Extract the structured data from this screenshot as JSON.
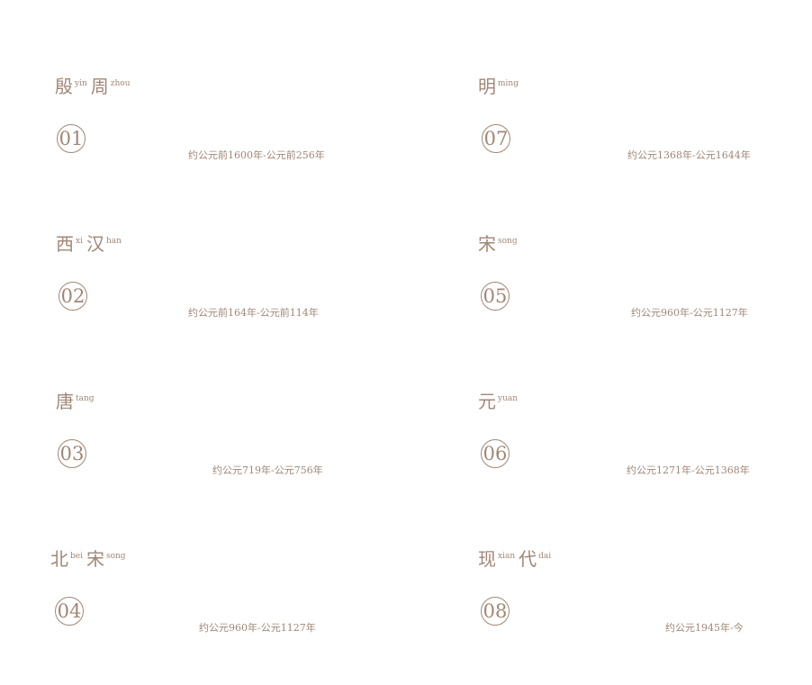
{
  "dynasties": [
    {
      "no": "01",
      "name": [
        {
          "c": "殷",
          "p": "yin"
        },
        {
          "c": "周",
          "p": "zhou"
        }
      ],
      "period": "约公元前1600年-公元前256年"
    },
    {
      "no": "02",
      "name": [
        {
          "c": "西",
          "p": "xi"
        },
        {
          "c": "汉",
          "p": "han"
        }
      ],
      "period": "约公元前164年-公元前114年"
    },
    {
      "no": "03",
      "name": [
        {
          "c": "唐",
          "p": "tang"
        }
      ],
      "period": "约公元719年-公元756年"
    },
    {
      "no": "04",
      "name": [
        {
          "c": "北",
          "p": "bei"
        },
        {
          "c": "宋",
          "p": "song"
        }
      ],
      "period": "约公元960年-公元1127年"
    },
    {
      "no": "07",
      "name": [
        {
          "c": "明",
          "p": "ming"
        }
      ],
      "period": "约公元1368年-公元1644年"
    },
    {
      "no": "05",
      "name": [
        {
          "c": "宋",
          "p": "song"
        }
      ],
      "period": "约公元960年-公元1127年"
    },
    {
      "no": "06",
      "name": [
        {
          "c": "元",
          "p": "yuan"
        }
      ],
      "period": "约公元1271年-公元1368年"
    },
    {
      "no": "08",
      "name": [
        {
          "c": "现",
          "p": "xian"
        },
        {
          "c": "代",
          "p": "dai"
        }
      ],
      "period": "约公元1945年-今"
    }
  ]
}
